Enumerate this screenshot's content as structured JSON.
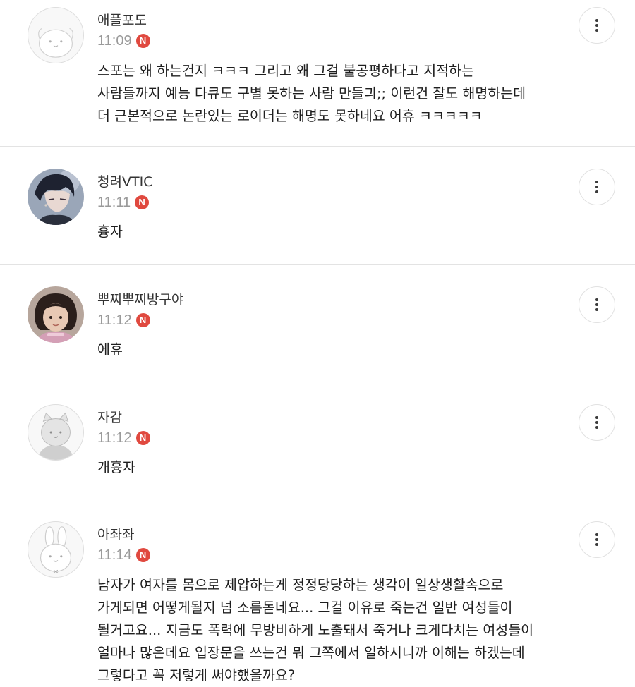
{
  "comments": [
    {
      "nickname": "애플포도",
      "time": "11:09",
      "badge": "N",
      "avatar_icon": "puppy-line-avatar-icon",
      "lines": [
        "스포는 왜 하는건지 ㅋㅋㅋ 그리고 왜 그걸 불공평하다고 지적하는",
        "사람들까지 예능 다큐도 구별 못하는 사람 만들긔;; 이런건 잘도 해명하는데",
        "더 근본적으로 논란있는 로이더는 해명도 못하네요 어휴 ㅋㅋㅋㅋㅋ"
      ]
    },
    {
      "nickname": "청려VTIC",
      "time": "11:11",
      "badge": "N",
      "avatar_icon": "anime-character-photo-avatar",
      "lines": [
        "흉자"
      ]
    },
    {
      "nickname": "뿌찌뿌찌방구야",
      "time": "11:12",
      "badge": "N",
      "avatar_icon": "child-photo-avatar",
      "lines": [
        "에휴"
      ]
    },
    {
      "nickname": "자감",
      "time": "11:12",
      "badge": "N",
      "avatar_icon": "cat-gray-avatar-icon",
      "lines": [
        "개흉자"
      ]
    },
    {
      "nickname": "아좌좌",
      "time": "11:14",
      "badge": "N",
      "avatar_icon": "rabbit-line-avatar-icon",
      "lines": [
        "남자가 여자를 몸으로 제압하는게 정정당당하는 생각이 일상생활속으로",
        "가게되면 어떻게될지 넘 소름돋네요... 그걸 이유로 죽는건 일반 여성들이",
        "될거고요... 지금도 폭력에 무방비하게 노출돼서 죽거나 크게다치는 여성들이",
        "얼마나 많은데요 입장문을 쓰는건 뭐 그쪽에서 일하시니까 이해는 하겠는데",
        "그렇다고 꼭 저렇게 써야했을까요?"
      ]
    }
  ],
  "colors": {
    "badge": "#e0493f",
    "time": "#9a9a9a",
    "divider": "#e3e3e3"
  }
}
